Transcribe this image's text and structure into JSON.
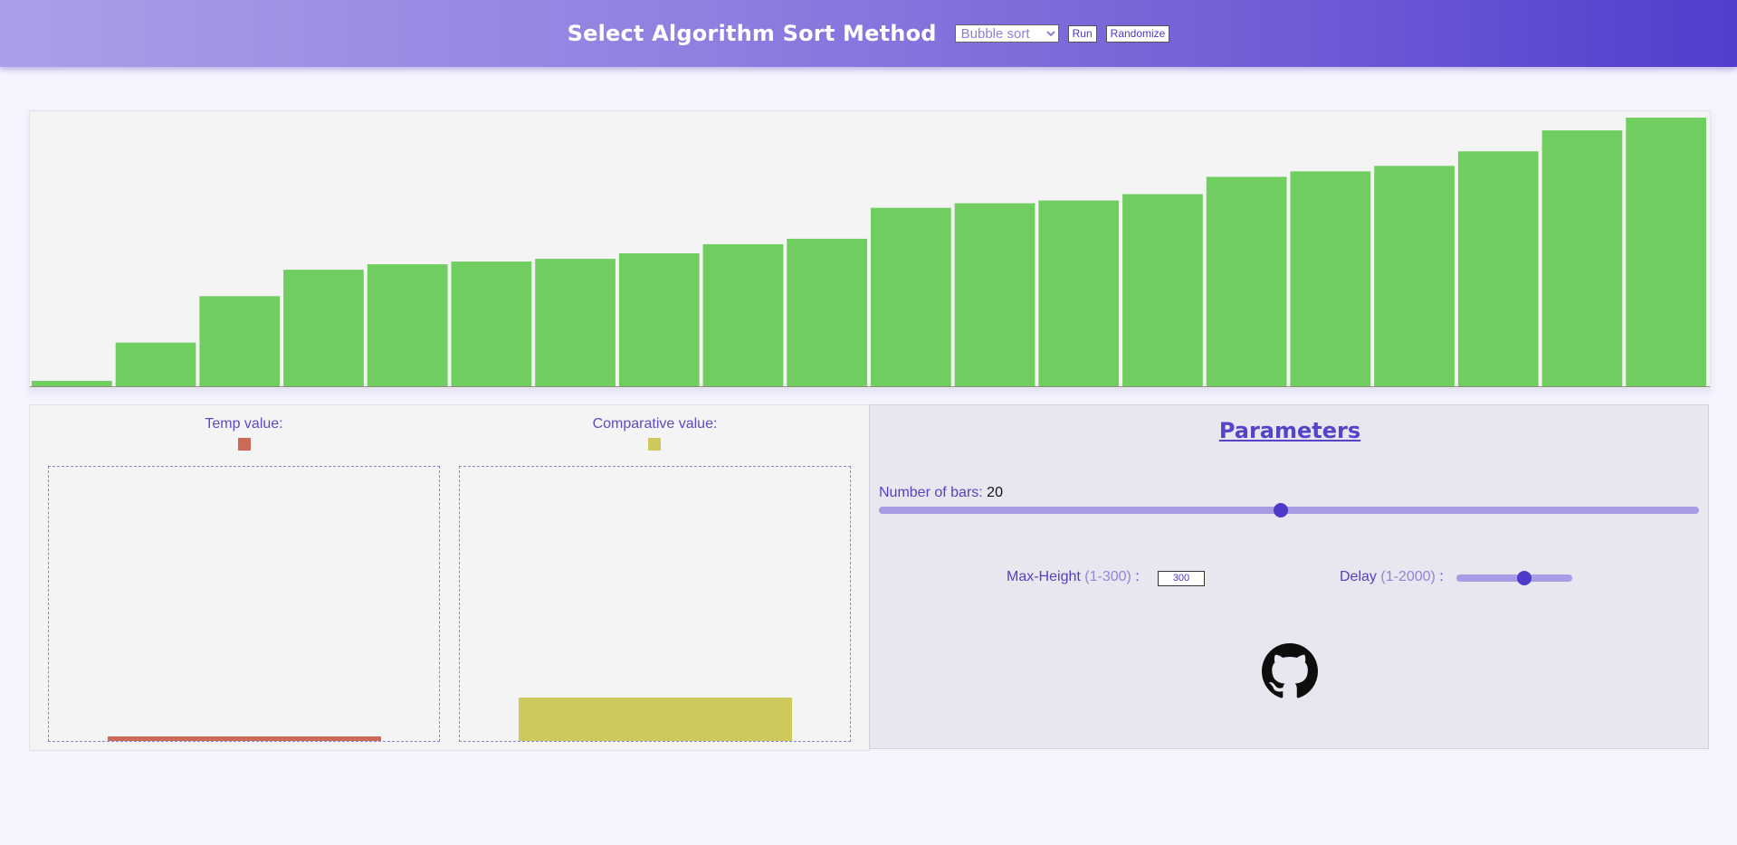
{
  "header": {
    "title": "Select Algorithm Sort Method",
    "algorithm_selected": "Bubble sort",
    "run_label": "Run",
    "randomize_label": "Randomize"
  },
  "colors": {
    "bar": "#6fce5f",
    "temp": "#cc6a58",
    "comparative": "#cec95b",
    "accent": "#5543c8"
  },
  "bars": {
    "max_height": 300,
    "values": [
      6,
      48,
      99,
      128,
      134,
      137,
      140,
      146,
      156,
      162,
      196,
      201,
      204,
      211,
      230,
      236,
      242,
      258,
      281,
      295
    ]
  },
  "temp": {
    "label": "Temp value:",
    "value": 5,
    "max": 300
  },
  "comparative": {
    "label": "Comparative value:",
    "value": 48,
    "max": 300
  },
  "params": {
    "title": "Parameters",
    "nbars_label": "Number of bars:",
    "nbars_value": "20",
    "nbars_fraction": 0.49,
    "maxheight_label": "Max-Height",
    "maxheight_hint": "(1-300)",
    "maxheight_colon": ":",
    "maxheight_value": "300",
    "delay_label": "Delay",
    "delay_hint": "(1-2000)",
    "delay_colon": ":",
    "delay_fraction": 0.6
  },
  "icons": {
    "github": "github-icon"
  }
}
